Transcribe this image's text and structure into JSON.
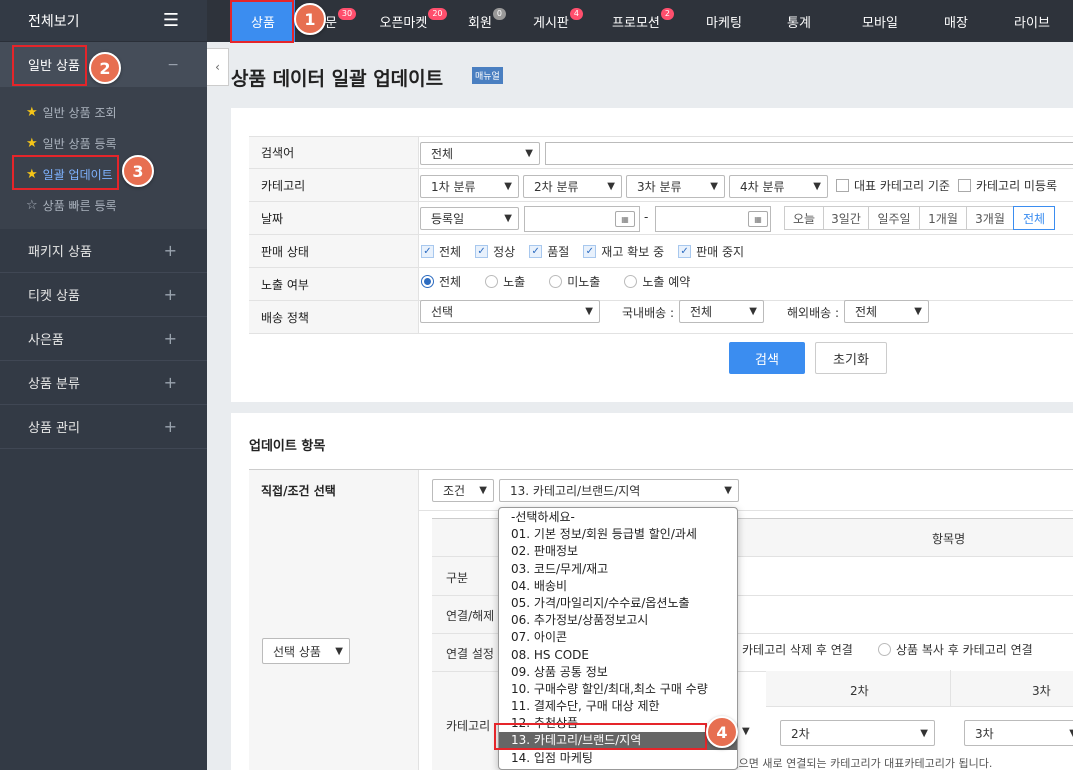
{
  "sidebar": {
    "header": "전체보기",
    "section": "일반 상품",
    "section_toggle": "−",
    "subitems": [
      {
        "label": "일반 상품 조회"
      },
      {
        "label": "일반 상품 등록"
      },
      {
        "label": "일괄 업데이트"
      },
      {
        "label": "상품 빠른 등록"
      }
    ],
    "items": [
      {
        "label": "패키지 상품"
      },
      {
        "label": "티켓 상품"
      },
      {
        "label": "사은품"
      },
      {
        "label": "상품 분류"
      },
      {
        "label": "상품 관리"
      }
    ],
    "plus": "+"
  },
  "topnav": {
    "items": [
      {
        "label": "상품",
        "count": ""
      },
      {
        "label": "주문",
        "count": "30"
      },
      {
        "label": "오픈마켓",
        "count": "20"
      },
      {
        "label": "회원",
        "count": "0"
      },
      {
        "label": "게시판",
        "count": "4"
      },
      {
        "label": "프로모션",
        "count": "2"
      },
      {
        "label": "마케팅",
        "count": ""
      },
      {
        "label": "통계",
        "count": ""
      },
      {
        "label": "모바일",
        "count": ""
      },
      {
        "label": "매장",
        "count": ""
      },
      {
        "label": "라이브",
        "count": ""
      }
    ]
  },
  "callouts": [
    "1",
    "2",
    "3",
    "4"
  ],
  "page": {
    "title": "상품 데이터 일괄 업데이트",
    "manual": "매뉴얼"
  },
  "search": {
    "keyword_label": "검색어",
    "keyword_select": "전체",
    "category_label": "카테고리",
    "cat1": "1차 분류",
    "cat2": "2차 분류",
    "cat3": "3차 분류",
    "cat4": "4차 분류",
    "cat_rep": "대표 카테고리 기준",
    "cat_unreg": "카테고리 미등록",
    "date_label": "날짜",
    "date_select": "등록일",
    "date_sep": "-",
    "date_buttons": [
      "오늘",
      "3일간",
      "일주일",
      "1개월",
      "3개월",
      "전체"
    ],
    "status_label": "판매 상태",
    "status_opts": [
      "전체",
      "정상",
      "품절",
      "재고 확보 중",
      "판매 중지"
    ],
    "expose_label": "노출 여부",
    "expose_opts": [
      "전체",
      "노출",
      "미노출",
      "노출 예약"
    ],
    "ship_label": "배송 정책",
    "ship_select": "선택",
    "domestic_label": "국내배송 :",
    "domestic_select": "전체",
    "overseas_label": "해외배송 :",
    "overseas_select": "전체",
    "search_btn": "검색",
    "reset_btn": "초기화"
  },
  "update": {
    "title": "업데이트 항목",
    "mode_label": "직접/조건 선택",
    "mode_select": "조건",
    "item_select": "13. 카테고리/브랜드/지역",
    "product_select": "선택 상품",
    "table_header": "항목명",
    "row_labels": [
      "구분",
      "연결/해제",
      "연결 설정",
      "카테고리"
    ],
    "link_opt1": "카테고리 삭제 후 연결",
    "link_opt2": "상품 복사 후 카테고리 연결",
    "col2": "2차",
    "col3": "3차",
    "sel2": "2차",
    "sel3": "3차",
    "note": "※ 상품에 연결된 카테고리가 없으면 새로 연결되는 카테고리가 대표카테고리가 됩니다."
  },
  "dropdown": {
    "options": [
      "-선택하세요-",
      "01. 기본 정보/회원 등급별 할인/과세",
      "02. 판매정보",
      "03. 코드/무게/재고",
      "04. 배송비",
      "05. 가격/마일리지/수수료/옵션노출",
      "06. 추가정보/상품정보고시",
      "07. 아이콘",
      "08. HS CODE",
      "09. 상품 공통 정보",
      "10. 구매수량 할인/최대,최소 구매 수량",
      "11. 결제수단, 구매 대상 제한",
      "12. 추천상품",
      "13. 카테고리/브랜드/지역",
      "14. 입점 마케팅"
    ],
    "selected_index": 13
  }
}
